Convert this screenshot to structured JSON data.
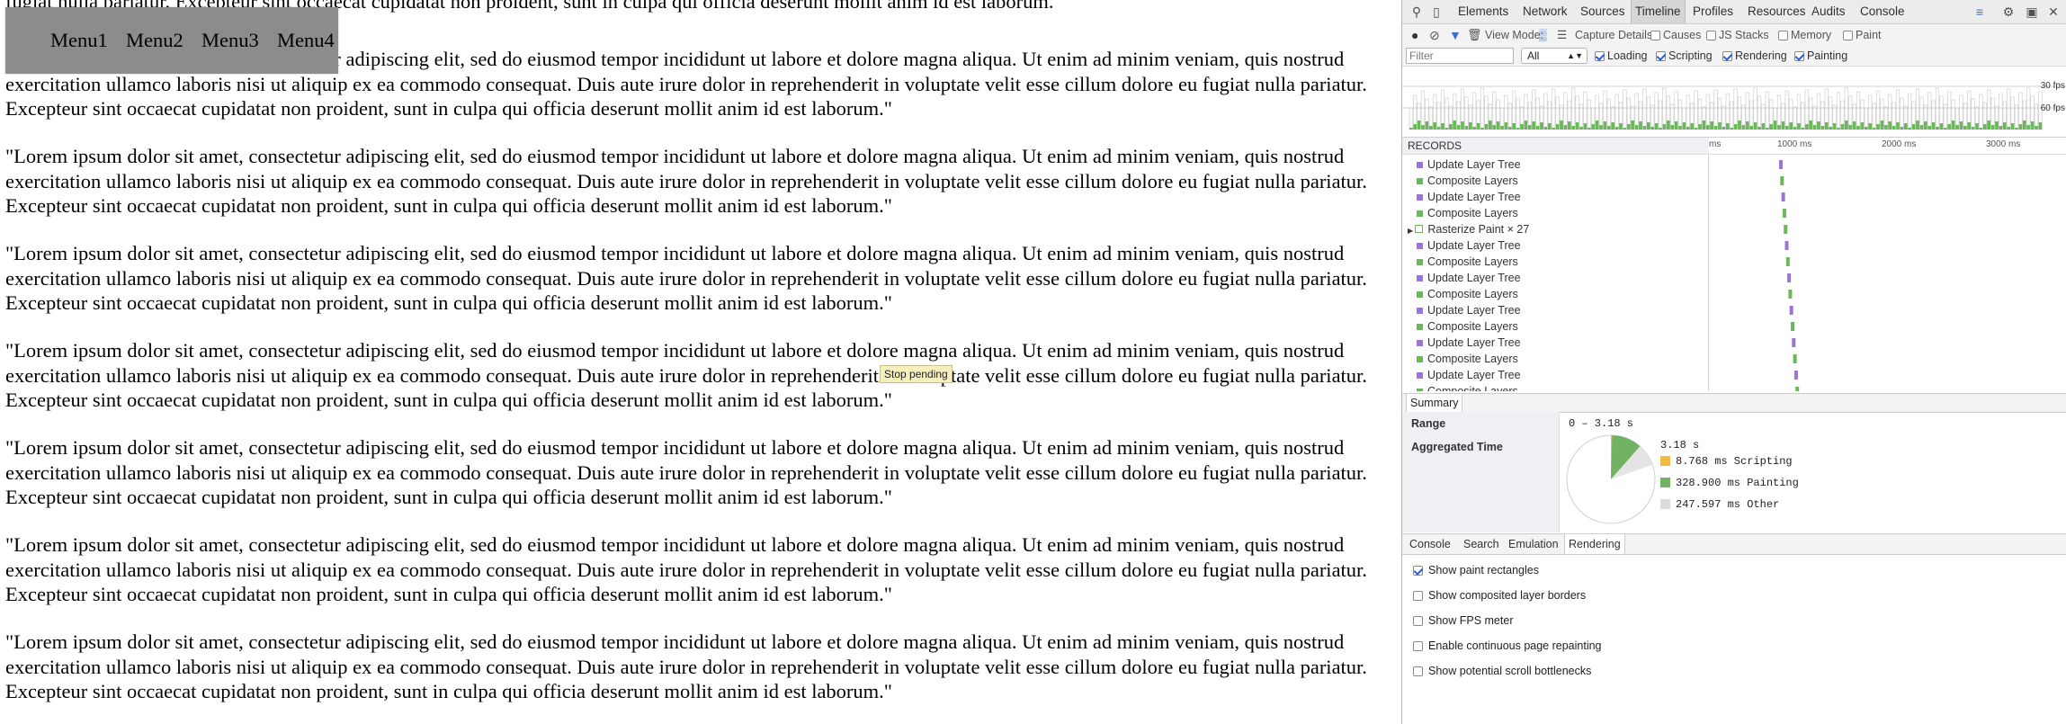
{
  "page": {
    "partial_top_line": "fugiat nulla pariatur. Excepteur sint occaecat cupidatat non proident, sunt in culpa qui officia deserunt mollit anim id est laborum.\"",
    "paragraph_text": "\"Lorem ipsum dolor sit amet, consectetur adipiscing elit, sed do eiusmod tempor incididunt ut labore et dolore magna aliqua. Ut enim ad minim veniam, quis nostrud exercitation ullamco laboris nisi ut aliquip ex ea commodo consequat. Duis aute irure dolor in reprehenderit in voluptate velit esse cillum dolore eu fugiat nulla pariatur. Excepteur sint occaecat cupidatat non proident, sunt in culpa qui officia deserunt mollit anim id est laborum.\"",
    "paragraphs": [
      "\"Lorem ipsum dolor sit amet, consectetur adipiscing elit, sed do eiusmod tempor incididunt ut labore et dolore magna aliqua. Ut enim ad minim veniam, quis nostrud exercitation ullamco laboris nisi ut aliquip ex ea commodo consequat. Duis aute irure dolor in reprehenderit in voluptate velit esse cillum dolore eu fugiat nulla pariatur. Excepteur sint occaecat cupidatat non proident, sunt in culpa qui officia deserunt mollit anim id est laborum.\"",
      "\"Lorem ipsum dolor sit amet, consectetur adipiscing elit, sed do eiusmod tempor incididunt ut labore et dolore magna aliqua. Ut enim ad minim veniam, quis nostrud exercitation ullamco laboris nisi ut aliquip ex ea commodo consequat. Duis aute irure dolor in reprehenderit in voluptate velit esse cillum dolore eu fugiat nulla pariatur. Excepteur sint occaecat cupidatat non proident, sunt in culpa qui officia deserunt mollit anim id est laborum.\"",
      "\"Lorem ipsum dolor sit amet, consectetur adipiscing elit, sed do eiusmod tempor incididunt ut labore et dolore magna aliqua. Ut enim ad minim veniam, quis nostrud exercitation ullamco laboris nisi ut aliquip ex ea commodo consequat. Duis aute irure dolor in reprehenderit in voluptate velit esse cillum dolore eu fugiat nulla pariatur. Excepteur sint occaecat cupidatat non proident, sunt in culpa qui officia deserunt mollit anim id est laborum.\"",
      "\"Lorem ipsum dolor sit amet, consectetur adipiscing elit, sed do eiusmod tempor incididunt ut labore et dolore magna aliqua. Ut enim ad minim veniam, quis nostrud exercitation ullamco laboris nisi ut aliquip ex ea commodo consequat. Duis aute irure dolor in reprehenderit in voluptate velit esse cillum dolore eu fugiat nulla pariatur. Excepteur sint occaecat cupidatat non proident, sunt in culpa qui officia deserunt mollit anim id est laborum.\"",
      "\"Lorem ipsum dolor sit amet, consectetur adipiscing elit, sed do eiusmod tempor incididunt ut labore et dolore magna aliqua. Ut enim ad minim veniam, quis nostrud exercitation ullamco laboris nisi ut aliquip ex ea commodo consequat. Duis aute irure dolor in reprehenderit in voluptate velit esse cillum dolore eu fugiat nulla pariatur. Excepteur sint occaecat cupidatat non proident, sunt in culpa qui officia deserunt mollit anim id est laborum.\"",
      "\"Lorem ipsum dolor sit amet, consectetur adipiscing elit, sed do eiusmod tempor incididunt ut labore et dolore magna aliqua. Ut enim ad minim veniam, quis nostrud exercitation ullamco laboris nisi ut aliquip ex ea commodo consequat. Duis aute irure dolor in reprehenderit in voluptate velit esse cillum dolore eu fugiat nulla pariatur. Excepteur sint occaecat cupidatat non proident, sunt in culpa qui officia deserunt mollit anim id est laborum.\"",
      "\"Lorem ipsum dolor sit amet, consectetur adipiscing elit, sed do eiusmod tempor incididunt ut labore et dolore magna aliqua. Ut enim ad minim veniam, quis nostrud exercitation ullamco laboris nisi ut aliquip ex ea commodo consequat. Duis aute irure dolor in reprehenderit in voluptate velit esse cillum dolore eu fugiat nulla pariatur. Excepteur sint occaecat cupidatat non proident, sunt in culpa qui officia deserunt mollit anim id est laborum.\"",
      "\"Lorem ipsum dolor sit amet, consectetur adipiscing elit, sed do eiusmod tempor incididunt ut labore et dolore magna aliqua. Ut enim ad minim veniam, quis nostrud exercitation ullamco laboris nisi ut aliquip ex ea commodo consequat. Duis aute irure dolor in reprehenderit in voluptate velit esse cillum dolore eu fugiat nulla pariatur. Excepteur sint occaecat cupidatat non proident, sunt in culpa qui officia deserunt mollit anim id est laborum.\""
    ],
    "menu": [
      "Menu1",
      "Menu2",
      "Menu3",
      "Menu4"
    ],
    "tooltip": "Stop pending"
  },
  "devtools": {
    "tabs": [
      "Elements",
      "Network",
      "Sources",
      "Timeline",
      "Profiles",
      "Resources",
      "Audits",
      "Console"
    ],
    "active_tab": "Timeline",
    "toolbar": {
      "view_mode_label": "View Mode:",
      "capture_label": "Capture Details:",
      "causes": "Causes",
      "js_stacks": "JS Stacks",
      "memory": "Memory",
      "paint": "Paint"
    },
    "filter": {
      "placeholder": "Filter",
      "select_value": "All",
      "loading": "Loading",
      "scripting": "Scripting",
      "rendering": "Rendering",
      "painting": "Painting"
    },
    "overview": {
      "fps30": "30 fps",
      "fps60": "60 fps"
    },
    "records_header": "RECORDS",
    "ruler": [
      "ms",
      "1000 ms",
      "2000 ms",
      "3000 ms"
    ],
    "records": [
      {
        "label": "Update Layer Tree",
        "color": "#9a74d6"
      },
      {
        "label": "Composite Layers",
        "color": "#6bb85a"
      },
      {
        "label": "Update Layer Tree",
        "color": "#9a74d6"
      },
      {
        "label": "Composite Layers",
        "color": "#6bb85a"
      },
      {
        "label": "Rasterize Paint × 27",
        "color": "#ffffff"
      },
      {
        "label": "Update Layer Tree",
        "color": "#9a74d6"
      },
      {
        "label": "Composite Layers",
        "color": "#6bb85a"
      },
      {
        "label": "Update Layer Tree",
        "color": "#9a74d6"
      },
      {
        "label": "Composite Layers",
        "color": "#6bb85a"
      },
      {
        "label": "Update Layer Tree",
        "color": "#9a74d6"
      },
      {
        "label": "Composite Layers",
        "color": "#6bb85a"
      },
      {
        "label": "Update Layer Tree",
        "color": "#9a74d6"
      },
      {
        "label": "Composite Layers",
        "color": "#6bb85a"
      },
      {
        "label": "Update Layer Tree",
        "color": "#9a74d6"
      },
      {
        "label": "Composite Layers",
        "color": "#6bb85a"
      }
    ],
    "summary_tab": "Summary",
    "summary": {
      "range_label": "Range",
      "range_value": "0 – 3.18 s",
      "aggregated_label": "Aggregated Time",
      "total": "3.18 s",
      "items": [
        {
          "text": "8.768 ms Scripting",
          "color": "#f2bb44"
        },
        {
          "text": "328.900 ms Painting",
          "color": "#71b363"
        },
        {
          "text": "247.597 ms Other",
          "color": "#dcdcdc"
        }
      ]
    },
    "drawer_tabs": [
      "Console",
      "Search",
      "Emulation",
      "Rendering"
    ],
    "drawer_active": "Rendering",
    "rendering_options": [
      {
        "label": "Show paint rectangles",
        "checked": true
      },
      {
        "label": "Show composited layer borders",
        "checked": false
      },
      {
        "label": "Show FPS meter",
        "checked": false
      },
      {
        "label": "Enable continuous page repainting",
        "checked": false
      },
      {
        "label": "Show potential scroll bottlenecks",
        "checked": false
      }
    ]
  }
}
